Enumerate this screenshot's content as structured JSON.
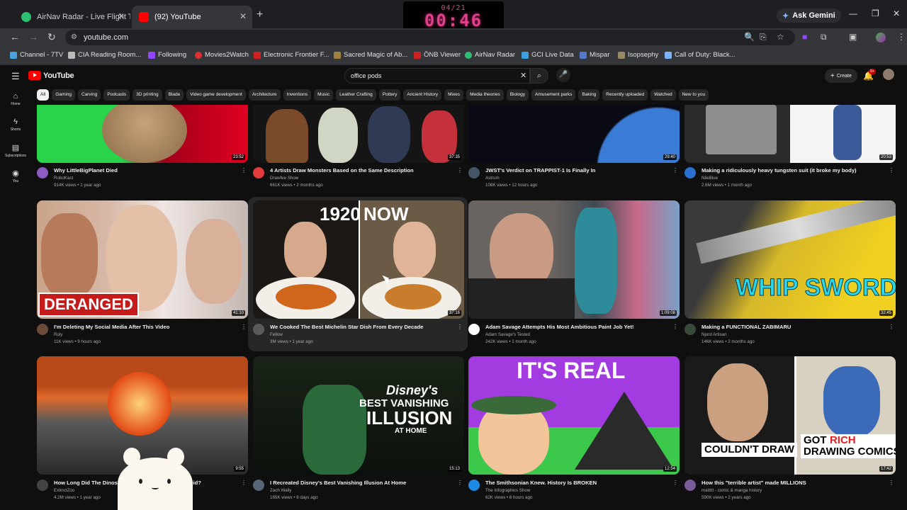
{
  "browser": {
    "tabs": [
      {
        "title": "AirNav Radar - Live Flight Track",
        "active": false,
        "favicon_color": "#2fbf71"
      },
      {
        "title": "(92) YouTube",
        "active": true,
        "favicon_color": "#ff0000"
      }
    ],
    "timer_date": "04/21",
    "timer_time": "00:46",
    "gemini_label": "Ask Gemini",
    "address": "youtube.com",
    "bookmarks": [
      {
        "label": "Channel - 7TV",
        "color": "#4aa3df"
      },
      {
        "label": "CIA Reading Room...",
        "color": "#bbbbbb"
      },
      {
        "label": "Following",
        "color": "#9146ff"
      },
      {
        "label": "Movies2Watch",
        "color": "#e03030"
      },
      {
        "label": "Electronic Frontier F...",
        "color": "#d02020"
      },
      {
        "label": "Sacred Magic of Ab...",
        "color": "#a08040"
      },
      {
        "label": "ÖNB Viewer",
        "color": "#cc2222"
      },
      {
        "label": "AirNav Radar",
        "color": "#2fbf71"
      },
      {
        "label": "GCI Live Data",
        "color": "#3aa0e0"
      },
      {
        "label": "Mispar",
        "color": "#5577cc"
      },
      {
        "label": "Isopsephy",
        "color": "#998866"
      },
      {
        "label": "Call of Duty: Black...",
        "color": "#7ab4ff"
      }
    ]
  },
  "youtube": {
    "logo": "YouTube",
    "search_value": "office pods",
    "create_label": "Create",
    "notif_badge": "9+",
    "sidebar": [
      {
        "label": "Home",
        "icon": "home-icon"
      },
      {
        "label": "Shorts",
        "icon": "shorts-icon"
      },
      {
        "label": "Subscriptions",
        "icon": "subscriptions-icon"
      },
      {
        "label": "You",
        "icon": "you-icon"
      }
    ],
    "chips": [
      "All",
      "Gaming",
      "Carving",
      "Podcasts",
      "3D printing",
      "Blade",
      "Video game development",
      "Architecture",
      "Inventions",
      "Music",
      "Leather Crafting",
      "Pottery",
      "Ancient History",
      "Mixes",
      "Media theories",
      "Biology",
      "Amusement parks",
      "Baking",
      "Recently uploaded",
      "Watched",
      "New to you"
    ],
    "videos": [
      {
        "title": "Why LittleBigPlanet Died",
        "channel": "RoboKast",
        "stats": "914K views • 1 year ago",
        "duration": "23:52",
        "avatar": "#8a5cc4"
      },
      {
        "title": "4 Artists Draw Monsters Based on the Same Description",
        "channel": "Drawfee Show",
        "stats": "661K views • 2 months ago",
        "duration": "37:35",
        "avatar": "#e23b3b"
      },
      {
        "title": "JWST's Verdict on TRAPPIST-1 Is Finally In",
        "channel": "Astrum",
        "stats": "108K views • 12 hours ago",
        "duration": "29:40",
        "avatar": "#445566"
      },
      {
        "title": "Making a ridiculously heavy tungsten suit (it broke my body)",
        "channel": "NileBlue",
        "stats": "2.6M views • 1 month ago",
        "duration": "20:53",
        "avatar": "#2b6fcf"
      },
      {
        "title": "I'm Deleting My Social Media After This Video",
        "channel": "Roly",
        "stats": "11K views • 9 hours ago",
        "duration": "41:10",
        "avatar": "#6b4a3a"
      },
      {
        "title": "We Cooked The Best Michelin Star Dish From Every Decade",
        "channel": "Fellow",
        "stats": "3M views • 1 year ago",
        "duration": "37:16",
        "avatar": "#5a5a5a"
      },
      {
        "title": "Adam Savage Attempts His Most Ambitious Paint Job Yet!",
        "channel": "Adam Savage's Tested",
        "stats": "242K views • 1 month ago",
        "duration": "1:09:08",
        "avatar": "#ffffff"
      },
      {
        "title": "Making a FUNCTIONAL ZABIMARU",
        "channel": "Njord Artisan",
        "stats": "146K views • 2 months ago",
        "duration": "32:45",
        "avatar": "#3a4a3a"
      },
      {
        "title": "How Long Did The Dinosaurs Survive After The Asteroid?",
        "channel": "ExtinctZoo",
        "stats": "4.2M views • 1 year ago",
        "duration": "9:55",
        "avatar": "#444444"
      },
      {
        "title": "I Recreated Disney's Best Vanishing Illusion At Home",
        "channel": "Zach Wally",
        "stats": "165K views • 8 days ago",
        "duration": "15:13",
        "avatar": "#556677"
      },
      {
        "title": "The Smithsonian Knew. History Is BROKEN",
        "channel": "The Infographics Show",
        "stats": "62K views • 8 hours ago",
        "duration": "12:54",
        "avatar": "#1e88e5"
      },
      {
        "title": "How this \"terrible artist\" made MILLIONS",
        "channel": "mattttt - comic & manga history",
        "stats": "590K views • 2 years ago",
        "duration": "17:42",
        "avatar": "#7a5c9a"
      }
    ],
    "thumb_text": {
      "deranged": "DERANGED",
      "year_1920": "1920",
      "now": "NOW",
      "whip": "WHIP SWORD",
      "disney": "Disney's",
      "best_vanishing": "BEST VANISHING",
      "illusion": "ILLUSION",
      "at_home": "AT HOME",
      "its_real": "IT'S REAL",
      "couldnt": "COULDN'T DRAW",
      "got": "GOT",
      "rich": "RICH",
      "drawing": "DRAWING COMICS"
    }
  }
}
